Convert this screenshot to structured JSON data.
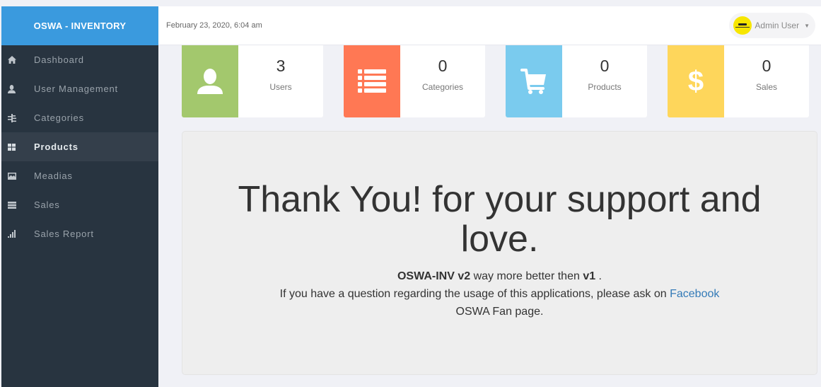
{
  "brand": {
    "title": "OSWA - INVENTORY",
    "color": "#3a9ade"
  },
  "topbar": {
    "datetime": "February 23, 2020, 6:04 am",
    "user": {
      "name": "Admin User",
      "avatar_color": "#f7e600",
      "caret_icon": "caret-down-icon"
    }
  },
  "sidebar": {
    "items": [
      {
        "label": "Dashboard",
        "icon": "home-icon",
        "active": false
      },
      {
        "label": "User Management",
        "icon": "user-icon",
        "active": false
      },
      {
        "label": "Categories",
        "icon": "indent-list-icon",
        "active": false
      },
      {
        "label": "Products",
        "icon": "th-large-icon",
        "active": true
      },
      {
        "label": "Meadias",
        "icon": "picture-icon",
        "active": false
      },
      {
        "label": "Sales",
        "icon": "th-list-icon",
        "active": false
      },
      {
        "label": "Sales Report",
        "icon": "signal-icon",
        "active": false
      }
    ]
  },
  "stats": [
    {
      "value": "3",
      "label": "Users",
      "icon": "user-icon",
      "color": "#a3c86d"
    },
    {
      "value": "0",
      "label": "Categories",
      "icon": "list-icon",
      "color": "#ff7854"
    },
    {
      "value": "0",
      "label": "Products",
      "icon": "shopping-cart-icon",
      "color": "#7acbee"
    },
    {
      "value": "0",
      "label": "Sales",
      "icon": "dollar-icon",
      "color": "#fed65b"
    }
  ],
  "panel": {
    "heading": "Thank You! for your support and love.",
    "line1": {
      "bold1": "OSWA-INV v2",
      "text": " way more better then ",
      "bold2": "v1",
      "end": " ."
    },
    "line2": {
      "text": "If you have a question regarding the usage of this applications, please ask on ",
      "link": "Facebook"
    },
    "line3": "OSWA Fan page.",
    "link_color": "#337ab7"
  }
}
